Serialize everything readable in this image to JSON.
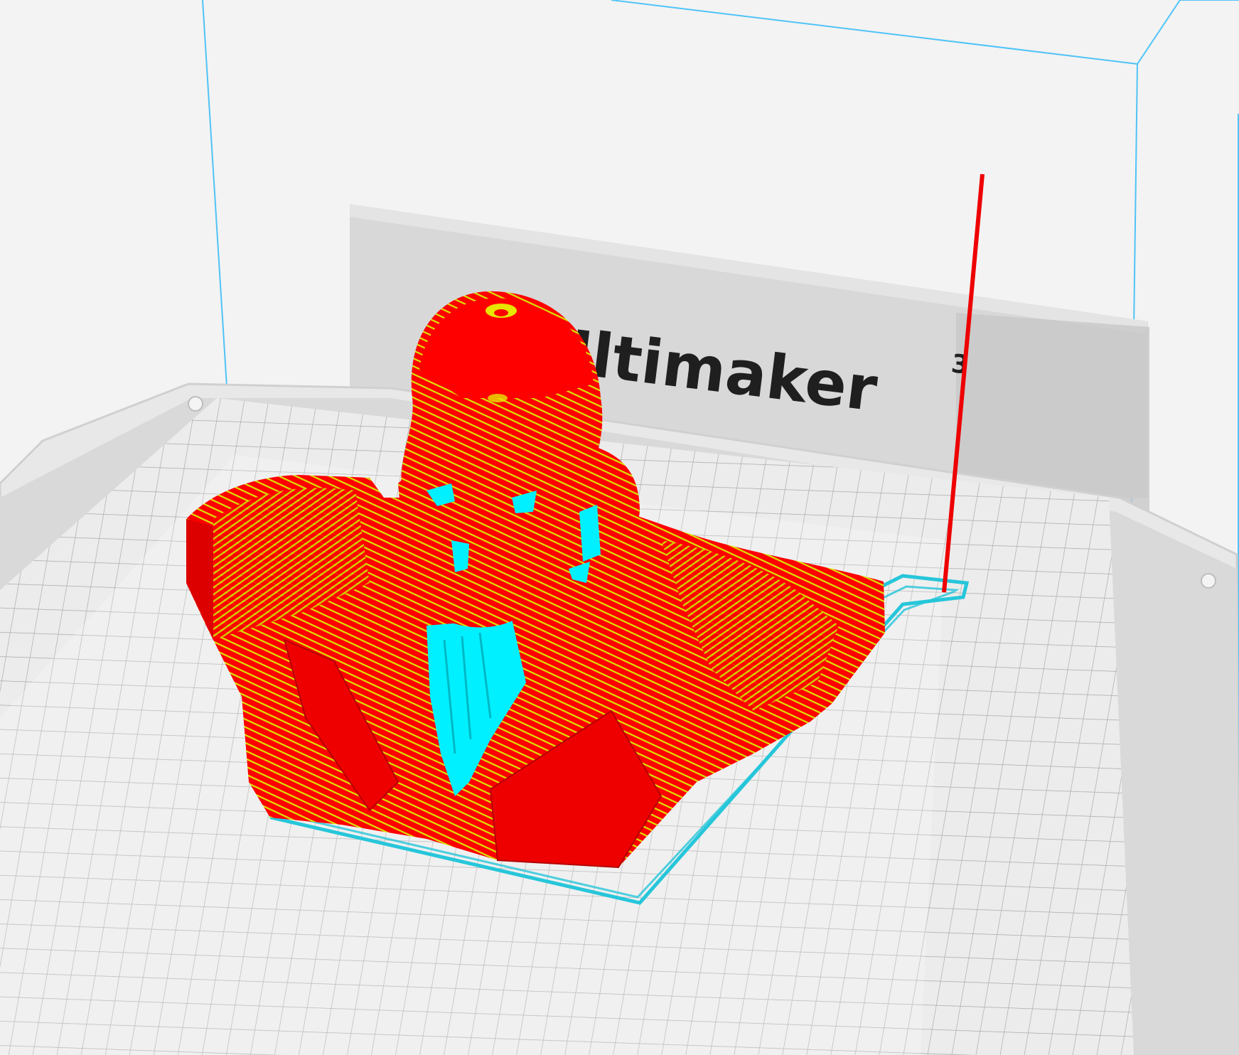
{
  "viewport": {
    "background_color": "#f3f3f3",
    "view": "layer-view"
  },
  "printer": {
    "brand_label": "Ultimaker",
    "model_suffix": "3",
    "build_volume_line_color": "#4fc3f7",
    "bed_color": "#dcdcdc",
    "grid_line_color": "#a8a8a8",
    "backplate_color": "#d6d6d6"
  },
  "model": {
    "name": "bust",
    "wall_color": "#ff0000",
    "infill_color": "#e6e600",
    "support_color": "#00f0ff",
    "skirt_color": "#26c6da"
  },
  "prime_tower": {
    "color": "#ee0000"
  }
}
